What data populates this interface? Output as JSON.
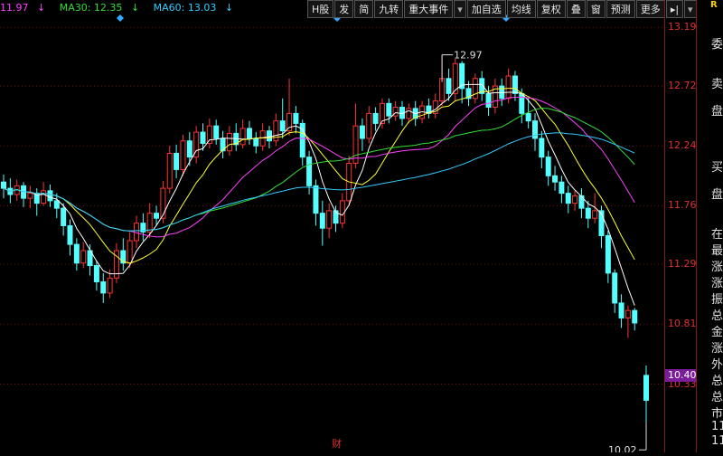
{
  "legend": {
    "price": "11.97",
    "ma30": "MA30: 12.35",
    "ma60": "MA60: 13.03",
    "arrow": "↓"
  },
  "toolbar": [
    {
      "label": "H股"
    },
    {
      "label": "发"
    },
    {
      "label": "简"
    },
    {
      "label": "九转"
    },
    {
      "label": "重大事件"
    },
    {
      "label": "▾",
      "dd": true
    },
    {
      "label": "加自选"
    },
    {
      "label": "均线"
    },
    {
      "label": "复权"
    },
    {
      "label": "叠"
    },
    {
      "label": "窗"
    },
    {
      "label": "预测"
    },
    {
      "label": "更多"
    },
    {
      "label": "▸|"
    },
    {
      "label": "▾",
      "dd": true
    }
  ],
  "price_axis": {
    "ticks": [
      "13.19",
      "12.72",
      "12.24",
      "11.76",
      "11.29",
      "10.81",
      "10.33"
    ],
    "current": "10.40",
    "high_label": "12.97",
    "low_label": "10.02"
  },
  "side_panel": {
    "logo": "R",
    "items": [
      "委",
      "卖",
      "盘",
      "买",
      "盘",
      "在",
      "最",
      "涨",
      "涨",
      "振",
      "总",
      "金",
      "涨",
      "外",
      "总",
      "总",
      "市",
      "11",
      "11"
    ]
  },
  "bottom": {
    "label": "财"
  },
  "colors": {
    "up": "#ff3333",
    "down": "#54ffff",
    "ma5": "#ffffff",
    "ma10": "#ffff33",
    "ma20": "#ff40ff",
    "ma30": "#33dd33",
    "ma60": "#33ccff",
    "axis": "#e03030",
    "grid": "#7a1010"
  },
  "chart_data": {
    "type": "candlestick",
    "ylim": [
      10.0,
      13.25
    ],
    "candles": [
      [
        11.95,
        11.9,
        12.01,
        11.82
      ],
      [
        11.9,
        11.85,
        11.98,
        11.78
      ],
      [
        11.85,
        11.92,
        11.97,
        11.8
      ],
      [
        11.92,
        11.82,
        11.95,
        11.75
      ],
      [
        11.82,
        11.86,
        11.92,
        11.74
      ],
      [
        11.86,
        11.78,
        11.9,
        11.68
      ],
      [
        11.78,
        11.88,
        11.95,
        11.76
      ],
      [
        11.88,
        11.8,
        11.93,
        11.75
      ],
      [
        11.8,
        11.74,
        11.86,
        11.66
      ],
      [
        11.74,
        11.6,
        11.78,
        11.52
      ],
      [
        11.6,
        11.45,
        11.65,
        11.36
      ],
      [
        11.45,
        11.3,
        11.5,
        11.24
      ],
      [
        11.3,
        11.4,
        11.47,
        11.26
      ],
      [
        11.4,
        11.28,
        11.45,
        11.2
      ],
      [
        11.28,
        11.15,
        11.32,
        11.08
      ],
      [
        11.15,
        11.06,
        11.22,
        10.98
      ],
      [
        11.06,
        11.18,
        11.25,
        11.02
      ],
      [
        11.18,
        11.4,
        11.46,
        11.14
      ],
      [
        11.4,
        11.3,
        11.5,
        11.24
      ],
      [
        11.3,
        11.48,
        11.55,
        11.26
      ],
      [
        11.48,
        11.62,
        11.68,
        11.42
      ],
      [
        11.62,
        11.55,
        11.7,
        11.48
      ],
      [
        11.55,
        11.7,
        11.78,
        11.5
      ],
      [
        11.7,
        11.66,
        11.76,
        11.6
      ],
      [
        11.66,
        11.9,
        11.96,
        11.62
      ],
      [
        11.9,
        12.18,
        12.24,
        11.86
      ],
      [
        12.18,
        12.05,
        12.25,
        11.98
      ],
      [
        12.05,
        12.28,
        12.33,
        12.0
      ],
      [
        12.28,
        12.15,
        12.35,
        12.08
      ],
      [
        12.15,
        12.35,
        12.4,
        12.1
      ],
      [
        12.35,
        12.26,
        12.42,
        12.2
      ],
      [
        12.26,
        12.4,
        12.46,
        12.22
      ],
      [
        12.4,
        12.3,
        12.45,
        12.25
      ],
      [
        12.3,
        12.2,
        12.36,
        12.14
      ],
      [
        12.2,
        12.34,
        12.4,
        12.16
      ],
      [
        12.34,
        12.25,
        12.42,
        12.2
      ],
      [
        12.25,
        12.38,
        12.45,
        12.22
      ],
      [
        12.38,
        12.3,
        12.44,
        12.25
      ],
      [
        12.3,
        12.24,
        12.35,
        12.18
      ],
      [
        12.24,
        12.36,
        12.42,
        12.2
      ],
      [
        12.36,
        12.28,
        12.4,
        12.22
      ],
      [
        12.28,
        12.44,
        12.5,
        12.24
      ],
      [
        12.44,
        12.36,
        12.62,
        12.3
      ],
      [
        12.36,
        12.5,
        12.78,
        12.32
      ],
      [
        12.5,
        12.42,
        12.56,
        12.34
      ],
      [
        12.42,
        12.15,
        12.45,
        12.08
      ],
      [
        12.15,
        11.92,
        12.2,
        11.85
      ],
      [
        11.92,
        11.7,
        11.97,
        11.6
      ],
      [
        11.7,
        11.58,
        11.8,
        11.44
      ],
      [
        11.58,
        11.72,
        11.78,
        11.5
      ],
      [
        11.72,
        11.62,
        11.76,
        11.55
      ],
      [
        11.62,
        11.8,
        11.86,
        11.58
      ],
      [
        11.8,
        12.1,
        12.16,
        11.76
      ],
      [
        12.1,
        12.4,
        12.58,
        12.06
      ],
      [
        12.4,
        12.3,
        12.46,
        12.2
      ],
      [
        12.3,
        12.5,
        12.56,
        12.26
      ],
      [
        12.5,
        12.42,
        12.55,
        12.36
      ],
      [
        12.42,
        12.58,
        12.62,
        12.38
      ],
      [
        12.58,
        12.48,
        12.62,
        12.42
      ],
      [
        12.48,
        12.55,
        12.6,
        12.44
      ],
      [
        12.55,
        12.46,
        12.6,
        12.4
      ],
      [
        12.46,
        12.54,
        12.58,
        12.42
      ],
      [
        12.54,
        12.46,
        12.6,
        12.4
      ],
      [
        12.46,
        12.56,
        12.6,
        12.42
      ],
      [
        12.56,
        12.5,
        12.62,
        12.46
      ],
      [
        12.5,
        12.6,
        12.66,
        12.46
      ],
      [
        12.6,
        12.78,
        12.97,
        12.56
      ],
      [
        12.78,
        12.66,
        12.86,
        12.6
      ],
      [
        12.66,
        12.9,
        12.94,
        12.6
      ],
      [
        12.9,
        12.7,
        12.92,
        12.58
      ],
      [
        12.7,
        12.62,
        12.76,
        12.56
      ],
      [
        12.62,
        12.78,
        12.82,
        12.58
      ],
      [
        12.78,
        12.66,
        12.84,
        12.6
      ],
      [
        12.66,
        12.55,
        12.72,
        12.48
      ],
      [
        12.55,
        12.72,
        12.78,
        12.5
      ],
      [
        12.72,
        12.62,
        12.78,
        12.56
      ],
      [
        12.62,
        12.8,
        12.86,
        12.58
      ],
      [
        12.8,
        12.66,
        12.84,
        12.6
      ],
      [
        12.66,
        12.5,
        12.7,
        12.42
      ],
      [
        12.5,
        12.44,
        12.62,
        12.38
      ],
      [
        12.44,
        12.3,
        12.5,
        12.2
      ],
      [
        12.3,
        12.15,
        12.36,
        12.06
      ],
      [
        12.15,
        12.0,
        12.2,
        11.92
      ],
      [
        12.0,
        11.95,
        12.08,
        11.88
      ],
      [
        11.95,
        11.86,
        12.0,
        11.78
      ],
      [
        11.86,
        11.78,
        11.92,
        11.7
      ],
      [
        11.78,
        11.84,
        11.88,
        11.72
      ],
      [
        11.84,
        11.74,
        11.9,
        11.66
      ],
      [
        11.74,
        11.66,
        11.8,
        11.58
      ],
      [
        11.66,
        11.72,
        11.86,
        11.62
      ],
      [
        11.72,
        11.52,
        11.76,
        11.42
      ],
      [
        11.52,
        11.22,
        11.56,
        11.14
      ],
      [
        11.22,
        10.98,
        11.25,
        10.9
      ],
      [
        10.98,
        10.86,
        11.05,
        10.78
      ],
      [
        10.86,
        10.92,
        10.96,
        10.7
      ],
      [
        10.92,
        10.82,
        10.94,
        10.76
      ],
      [
        10.4,
        10.2,
        10.48,
        10.02
      ]
    ]
  }
}
